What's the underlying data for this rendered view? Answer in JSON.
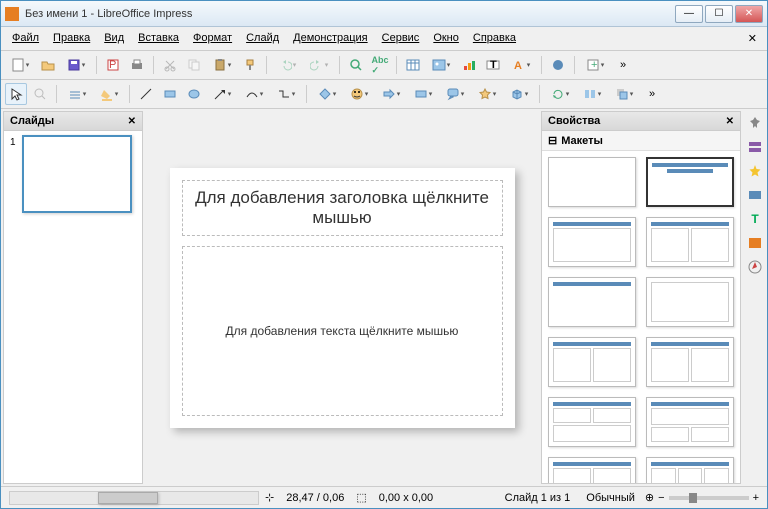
{
  "window": {
    "title": "Без имени 1 - LibreOffice Impress"
  },
  "menu": {
    "file": "Файл",
    "edit": "Правка",
    "view": "Вид",
    "insert": "Вставка",
    "format": "Формат",
    "slide": "Слайд",
    "demo": "Демонстрация",
    "tools": "Сервис",
    "window": "Окно",
    "help": "Справка"
  },
  "panes": {
    "slides": "Слайды",
    "properties": "Свойства",
    "layouts": "Макеты"
  },
  "slide": {
    "number": "1",
    "title_ph": "Для добавления заголовка щёлкните мышью",
    "body_ph": "Для добавления текста щёлкните мышью"
  },
  "status": {
    "pos": "28,47 / 0,06",
    "size": "0,00 x 0,00",
    "slideinfo": "Слайд 1 из 1",
    "mode": "Обычный"
  }
}
